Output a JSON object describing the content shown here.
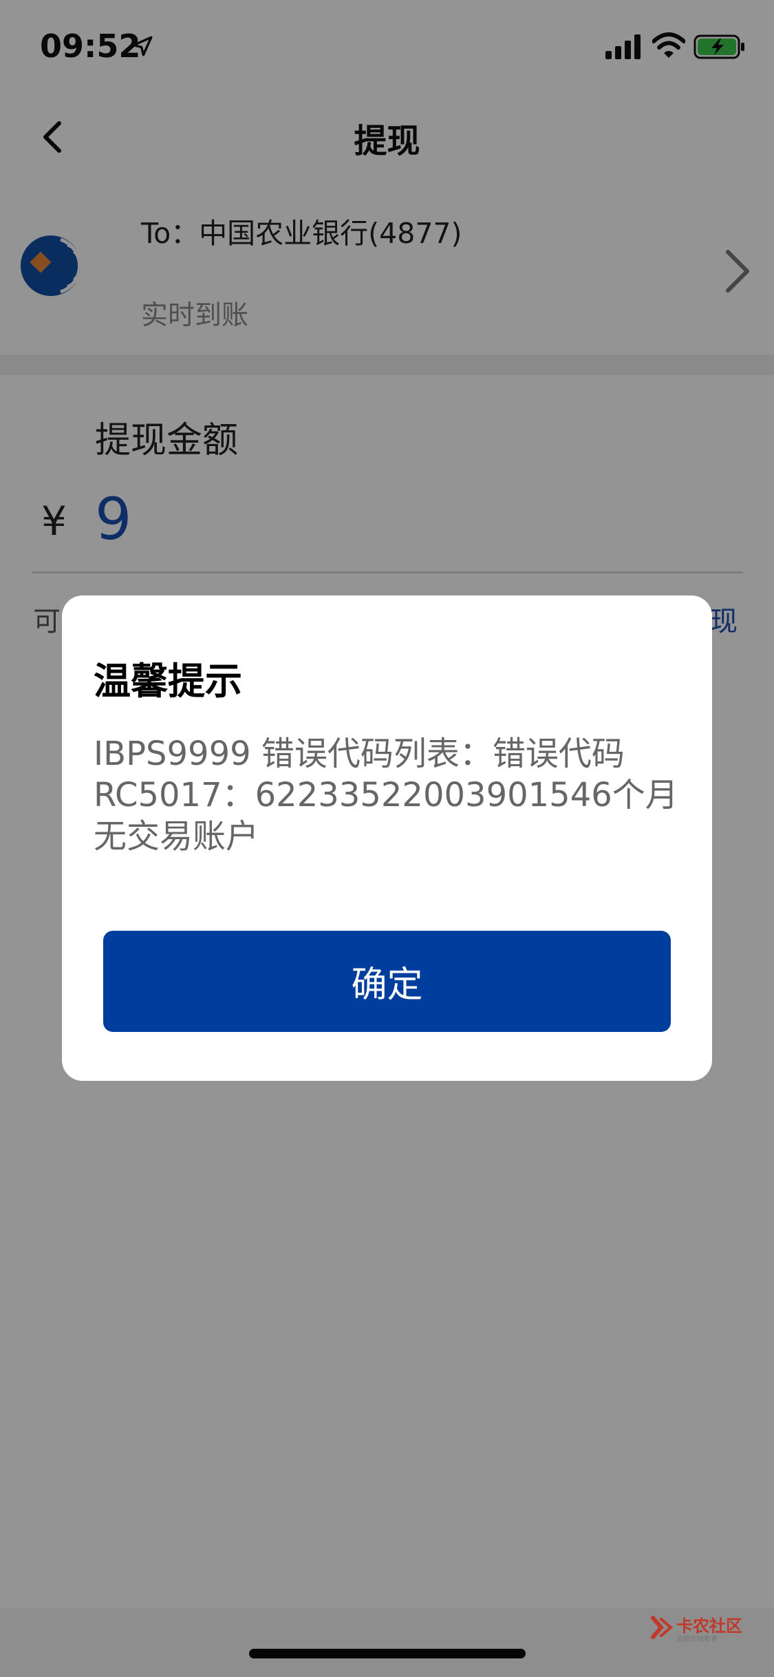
{
  "status_bar": {
    "time": "09:52"
  },
  "nav": {
    "title": "提现"
  },
  "bank": {
    "to_label": "To：中国农业银行(4877)",
    "subtitle": "实时到账"
  },
  "amount": {
    "label": "提现金额",
    "currency": "¥",
    "value": "9",
    "available_partial": "可",
    "withdraw_all_partial": "现"
  },
  "dialog": {
    "title": "温馨提示",
    "message": "IBPS9999 错误代码列表：错误代码RC5017：62233522003901546个月无交易账户",
    "confirm_label": "确定"
  },
  "watermark": {
    "text": "卡农社区",
    "subtext": "金融在线教育"
  },
  "colors": {
    "accent": "#003e9e",
    "amount_text": "#1a4fb0",
    "overlay": "rgba(0,0,0,0.42)"
  },
  "icons": {
    "back": "chevron-left-icon",
    "location": "location-arrow-icon",
    "signal": "cellular-signal-icon",
    "wifi": "wifi-icon",
    "battery": "battery-charging-icon",
    "bank_logo": "abc-bank-logo-icon",
    "disclosure": "chevron-right-icon"
  }
}
